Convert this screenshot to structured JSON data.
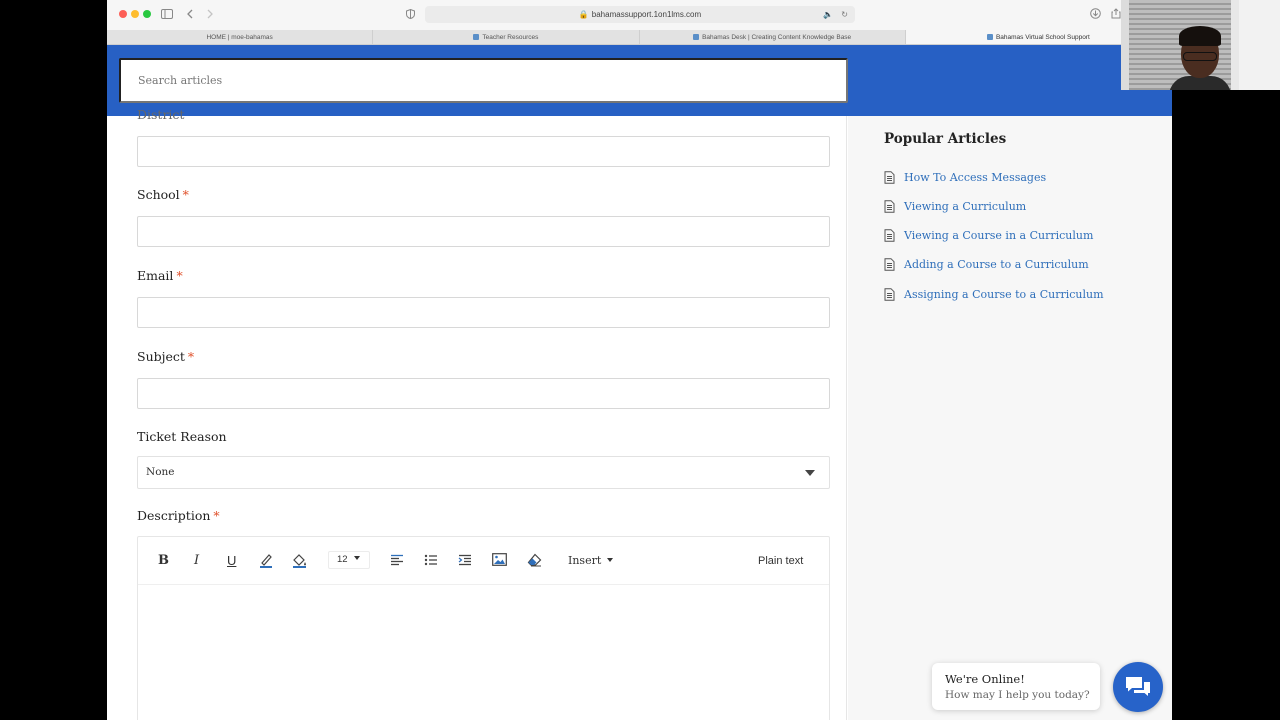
{
  "browser": {
    "url": "bahamassupport.1on1lms.com",
    "tabs": [
      {
        "label": "HOME | moe-bahamas",
        "active": false
      },
      {
        "label": "Teacher Resources",
        "active": false
      },
      {
        "label": "Bahamas Desk | Creating Content Knowledge Base",
        "active": false
      },
      {
        "label": "Bahamas Virtual School Support",
        "active": true
      }
    ]
  },
  "header": {
    "search_placeholder": "Search articles",
    "color": "#2760c4"
  },
  "form": {
    "district_label": "District",
    "school_label": "School",
    "email_label": "Email",
    "subject_label": "Subject",
    "required_mark": "*",
    "ticket_reason_label": "Ticket Reason",
    "ticket_reason_value": "None",
    "description_label": "Description",
    "editor": {
      "bold": "B",
      "italic": "I",
      "underline": "U",
      "font_size": "12",
      "insert_label": "Insert",
      "plain_text_label": "Plain text"
    }
  },
  "sidebar": {
    "title": "Popular Articles",
    "articles": [
      "How To Access Messages",
      "Viewing a Curriculum",
      "Viewing a Course in a Curriculum",
      "Adding a Course to a Curriculum",
      "Assigning a Course to a Curriculum"
    ]
  },
  "chat": {
    "title": "We're Online!",
    "subtitle": "How may I help you today?"
  },
  "colors": {
    "accent": "#2760c4",
    "link": "#2f6fba",
    "required": "#e0502a"
  }
}
